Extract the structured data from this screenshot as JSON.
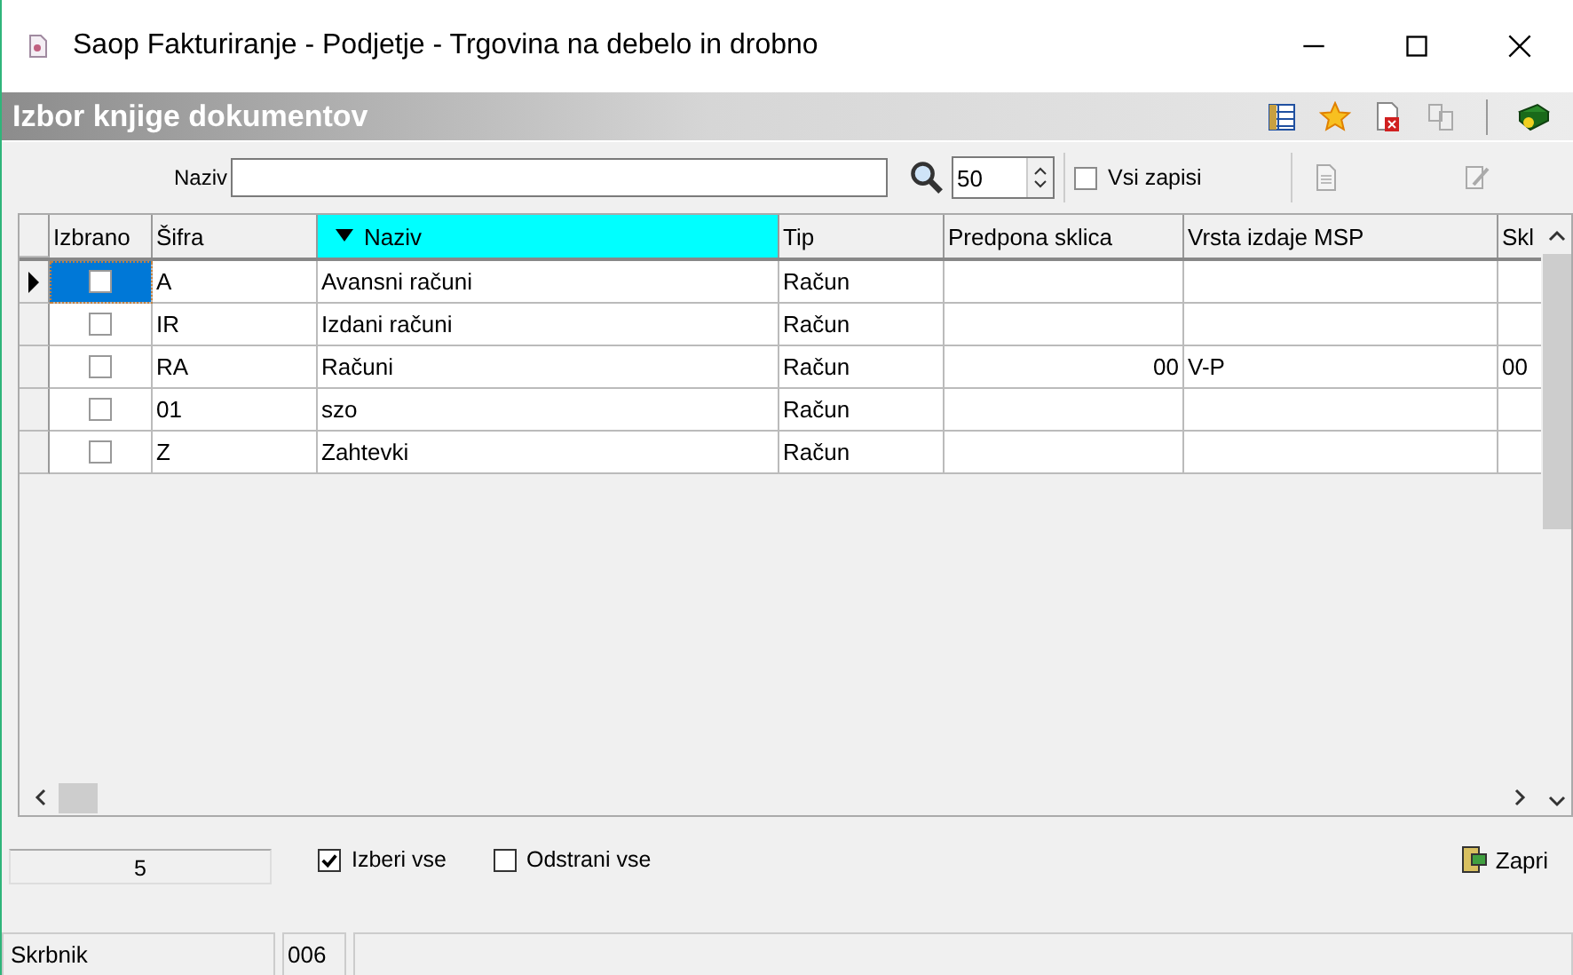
{
  "window": {
    "title": "Saop Fakturiranje - Podjetje - Trgovina na debelo in drobno"
  },
  "panel": {
    "title": "Izbor knjige dokumentov"
  },
  "filter": {
    "label": "Naziv",
    "count": "50",
    "all_records": {
      "label": "Vsi zapisi",
      "checked": false
    }
  },
  "table": {
    "select_column": "Izbrano",
    "columns": [
      {
        "label": "Šifra",
        "sorted": false
      },
      {
        "label": "Naziv",
        "sorted": true
      },
      {
        "label": "Tip",
        "sorted": false
      },
      {
        "label": "Predpona sklica",
        "sorted": false
      },
      {
        "label": "Vrsta izdaje MSP",
        "sorted": false
      },
      {
        "label": "Skl",
        "sorted": false
      }
    ],
    "rows": [
      {
        "current": true,
        "checked": false,
        "cells": [
          "A",
          "Avansni računi",
          "Račun",
          "",
          "",
          ""
        ]
      },
      {
        "current": false,
        "checked": false,
        "cells": [
          "IR",
          "Izdani računi",
          "Račun",
          "",
          "",
          ""
        ]
      },
      {
        "current": false,
        "checked": false,
        "cells": [
          "RA",
          "Računi",
          "Račun",
          "00",
          "V-P",
          "00"
        ]
      },
      {
        "current": false,
        "checked": false,
        "cells": [
          "01",
          "szo",
          "Račun",
          "",
          "",
          ""
        ]
      },
      {
        "current": false,
        "checked": false,
        "cells": [
          "Z",
          "Zahtevki",
          "Račun",
          "",
          "",
          ""
        ]
      }
    ]
  },
  "footer": {
    "count": "5",
    "select_all": {
      "label": "Izberi vse",
      "checked": true
    },
    "remove_all": {
      "label": "Odstrani vse",
      "checked": false
    },
    "close": "Zapri"
  },
  "status_bar": {
    "user": "Skrbnik",
    "code": "006"
  }
}
